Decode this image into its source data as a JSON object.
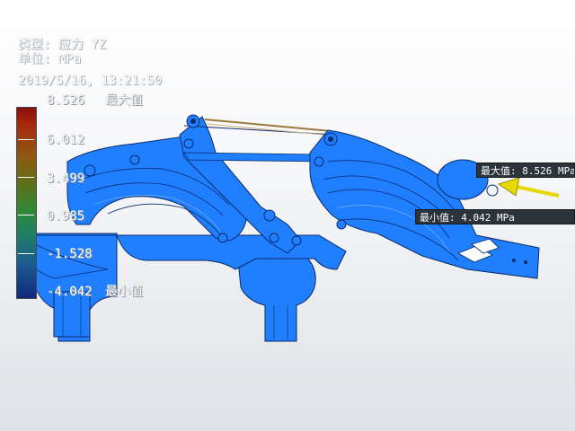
{
  "header": {
    "type_label": "类型: 应力 YZ",
    "unit_label": "单位: MPa",
    "timestamp": "2019/5/16, 13:21:50"
  },
  "legend": {
    "max_label": "最大值",
    "min_label": "最小值",
    "values": [
      "8.526",
      "6.012",
      "3.499",
      "0.985",
      "-1.528",
      "-4.042"
    ],
    "colors": {
      "high": "#8a0e0e",
      "upper_mid": "#8e5a10",
      "mid": "#2e8a3a",
      "low_mid": "#1d5a92",
      "low": "#12287a"
    }
  },
  "probes": {
    "max": {
      "label": "最大值: 8.526 MPa"
    },
    "min": {
      "label": "最小值: 4.042 MPa"
    },
    "arrow_color": "#e8d800"
  },
  "model": {
    "part_color": "#1f7fff",
    "edge_color": "#0a2a6a",
    "link_color": "#9a7a3a"
  }
}
